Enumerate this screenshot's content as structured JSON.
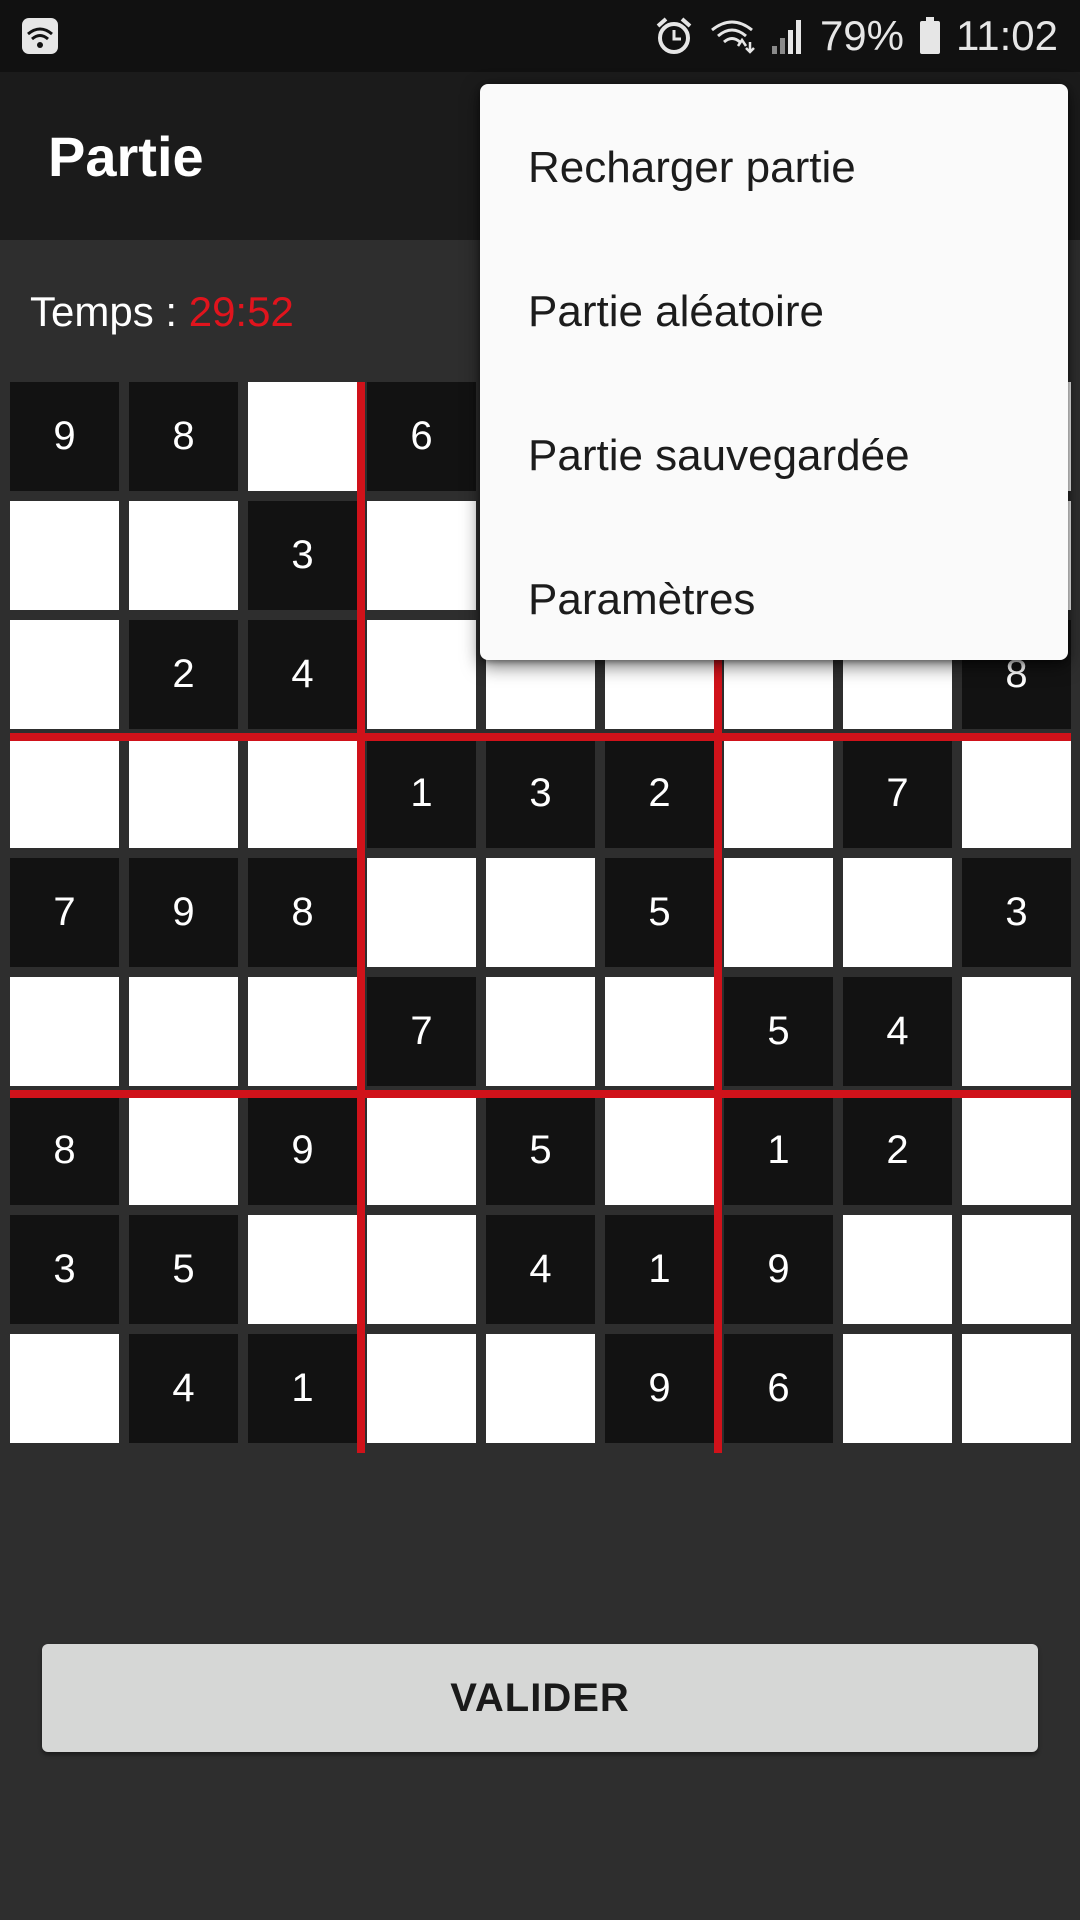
{
  "status_bar": {
    "battery_percent": "79%",
    "time": "11:02",
    "icons": [
      "wifi-icon",
      "alarm-icon",
      "wifi-data-icon",
      "signal-icon",
      "battery-icon"
    ]
  },
  "app_bar": {
    "title": "Partie"
  },
  "timer": {
    "label": "Temps : ",
    "value": "29:52",
    "value_color": "#e0141d"
  },
  "grid": {
    "rows": [
      [
        "9",
        "8",
        "",
        "6",
        "",
        "",
        "",
        "",
        ""
      ],
      [
        "",
        "",
        "3",
        "",
        "",
        "",
        "",
        "",
        ""
      ],
      [
        "",
        "2",
        "4",
        "",
        "",
        "",
        "",
        "",
        "8"
      ],
      [
        "",
        "",
        "",
        "1",
        "3",
        "2",
        "",
        "7",
        ""
      ],
      [
        "7",
        "9",
        "8",
        "",
        "",
        "5",
        "",
        "",
        "3"
      ],
      [
        "",
        "",
        "",
        "7",
        "",
        "",
        "5",
        "4",
        ""
      ],
      [
        "8",
        "",
        "9",
        "",
        "5",
        "",
        "1",
        "2",
        ""
      ],
      [
        "3",
        "5",
        "",
        "",
        "4",
        "1",
        "9",
        "",
        ""
      ],
      [
        "",
        "4",
        "1",
        "",
        "",
        "9",
        "6",
        "",
        ""
      ]
    ],
    "line_color": "#d0121a"
  },
  "validate_button": {
    "label": "VALIDER"
  },
  "menu": {
    "items": [
      {
        "label": "Recharger partie"
      },
      {
        "label": "Partie aléatoire"
      },
      {
        "label": "Partie sauvegardée"
      },
      {
        "label": "Paramètres"
      }
    ]
  }
}
